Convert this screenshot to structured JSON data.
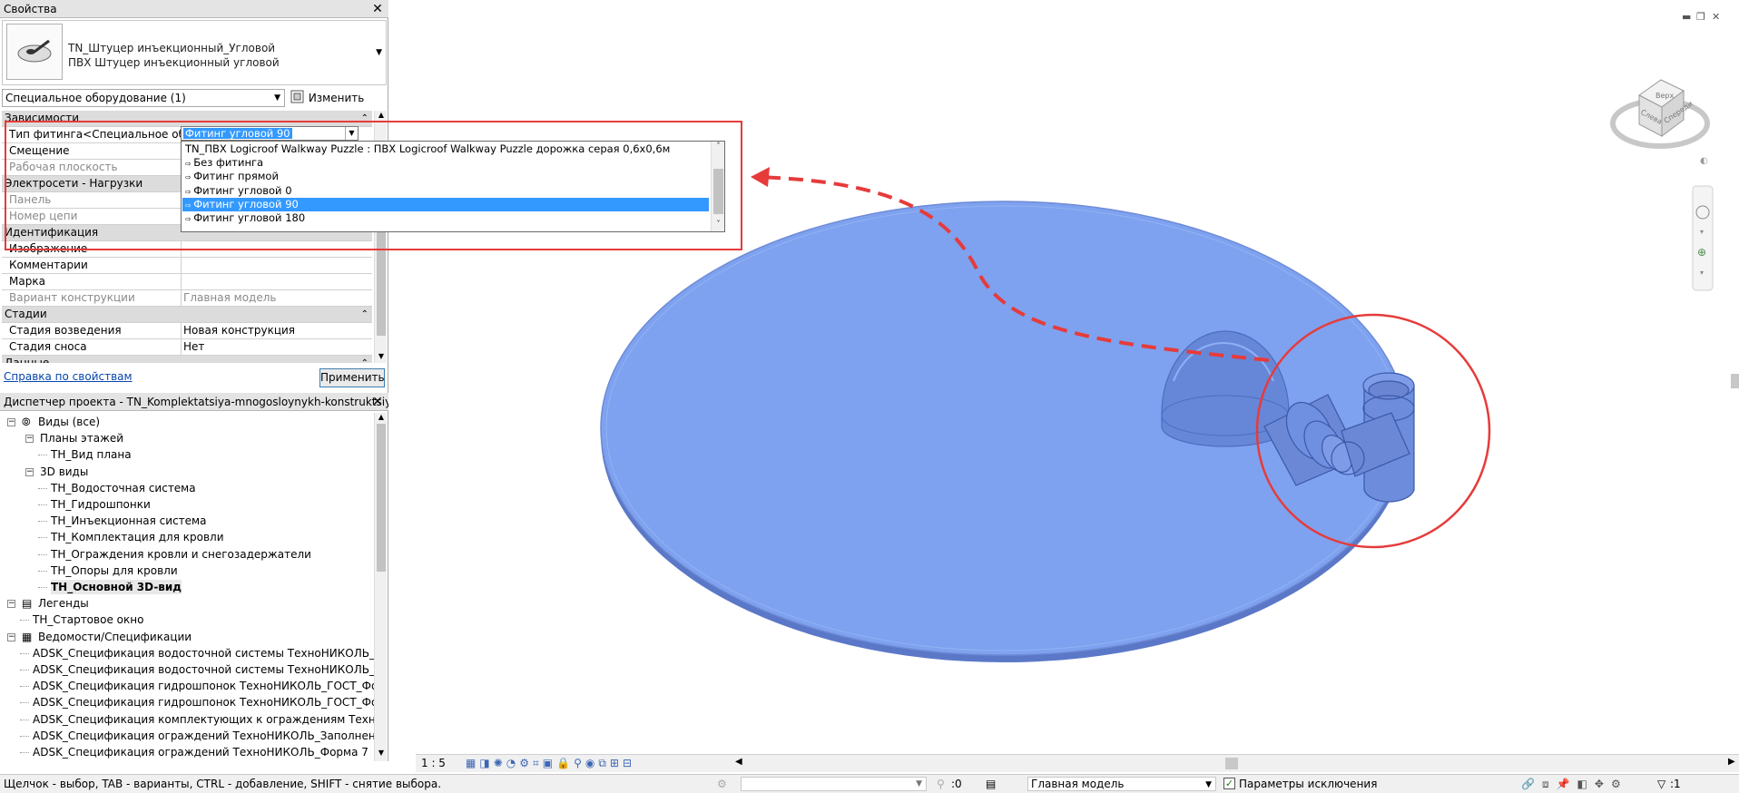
{
  "properties": {
    "title": "Свойства",
    "type_name_line1": "TN_Штуцер инъекционный_Угловой",
    "type_name_line2": "ПВХ Штуцер инъекционный угловой",
    "category_filter": "Специальное оборудование (1)",
    "edit_type_label": "Изменить тип",
    "rows": [
      {
        "kind": "group",
        "key": "Зависимости"
      },
      {
        "kind": "param",
        "key": "Тип фитинга<Специальное обо...",
        "value": ""
      },
      {
        "kind": "param",
        "key": "Смещение",
        "value": ""
      },
      {
        "kind": "readonly",
        "key": "Рабочая плоскость",
        "value": ""
      },
      {
        "kind": "group",
        "key": "Электросети - Нагрузки"
      },
      {
        "kind": "readonly",
        "key": "Панель",
        "value": ""
      },
      {
        "kind": "readonly",
        "key": "Номер цепи",
        "value": ""
      },
      {
        "kind": "group",
        "key": "Идентификация"
      },
      {
        "kind": "param",
        "key": "Изображение",
        "value": ""
      },
      {
        "kind": "param",
        "key": "Комментарии",
        "value": ""
      },
      {
        "kind": "param",
        "key": "Марка",
        "value": ""
      },
      {
        "kind": "readonly",
        "key": "Вариант конструкции",
        "value": "Главная модель"
      },
      {
        "kind": "group",
        "key": "Стадии"
      },
      {
        "kind": "param",
        "key": "Стадия возведения",
        "value": "Новая конструкция"
      },
      {
        "kind": "param",
        "key": "Стадия сноса",
        "value": "Нет"
      },
      {
        "kind": "group",
        "key": "Данные"
      }
    ],
    "fitting_value": "Фитинг угловой 90",
    "help_link": "Справка по свойствам",
    "apply_label": "Применить"
  },
  "fitting_dropdown": {
    "options": [
      "TN_ПВХ Logicroof Walkway Puzzle : ПВХ Logicroof Walkway Puzzle дорожка серая 0,6х0,6м",
      "Без фитинга",
      "Фитинг прямой",
      "Фитинг угловой 0",
      "Фитинг угловой 90",
      "Фитинг угловой 180"
    ],
    "selected_index": 4
  },
  "project_browser": {
    "title": "Диспетчер проекта - TN_Komplektatsiya-mnogosloynykh-konstruktsiy_TEK...",
    "nodes": [
      {
        "level": 0,
        "label": "Виды (все)",
        "expander": "-",
        "icon": "views"
      },
      {
        "level": 1,
        "label": "Планы этажей",
        "expander": "-"
      },
      {
        "level": 2,
        "label": "ТН_Вид плана"
      },
      {
        "level": 1,
        "label": "3D виды",
        "expander": "-"
      },
      {
        "level": 2,
        "label": "ТН_Водосточная система"
      },
      {
        "level": 2,
        "label": "ТН_Гидрошпонки"
      },
      {
        "level": 2,
        "label": "ТН_Инъекционная система"
      },
      {
        "level": 2,
        "label": "ТН_Комплектация для кровли"
      },
      {
        "level": 2,
        "label": "ТН_Ограждения кровли и снегозадержатели"
      },
      {
        "level": 2,
        "label": "ТН_Опоры для кровли"
      },
      {
        "level": 2,
        "label": "ТН_Основной 3D-вид",
        "bold": true
      },
      {
        "level": 0,
        "label": "Легенды",
        "expander": "-",
        "icon": "legend"
      },
      {
        "level": 1,
        "label": "ТН_Стартовое окно"
      },
      {
        "level": 0,
        "label": "Ведомости/Спецификации",
        "expander": "-",
        "icon": "schedule"
      },
      {
        "level": 1,
        "label": "ADSK_Спецификация водосточной системы ТехноНИКОЛЬ_ГОСТ_"
      },
      {
        "level": 1,
        "label": "ADSK_Спецификация водосточной системы ТехноНИКОЛЬ_ГОСТ_"
      },
      {
        "level": 1,
        "label": "ADSK_Спецификация гидрошпонок ТехноНИКОЛЬ_ГОСТ_Форма '"
      },
      {
        "level": 1,
        "label": "ADSK_Спецификация гидрошпонок ТехноНИКОЛЬ_ГОСТ_Форма '"
      },
      {
        "level": 1,
        "label": "ADSK_Спецификация комплектующих к ограждениям ТехноНИКС"
      },
      {
        "level": 1,
        "label": "ADSK_Спецификация ограждений ТехноНИКОЛЬ_Заполнение да"
      },
      {
        "level": 1,
        "label": "ADSK_Спецификация ограждений ТехноНИКОЛЬ_Форма 7"
      }
    ]
  },
  "view_bar": {
    "scale": "1 : 5"
  },
  "viewcube": {
    "faces": [
      "Слева",
      "Спереди",
      "Верх"
    ]
  },
  "status_bar": {
    "hint": "Щелчок - выбор, TAB - варианты, CTRL - добавление, SHIFT - снятие выбора.",
    "count": ":0",
    "design_option": "Главная модель",
    "exclusion_label": "Параметры исключения",
    "filter_count": ":1"
  },
  "colors": {
    "accent_red": "#e63b3b",
    "selection_blue": "#3399ff",
    "model_blue": "#7ea2ef"
  }
}
